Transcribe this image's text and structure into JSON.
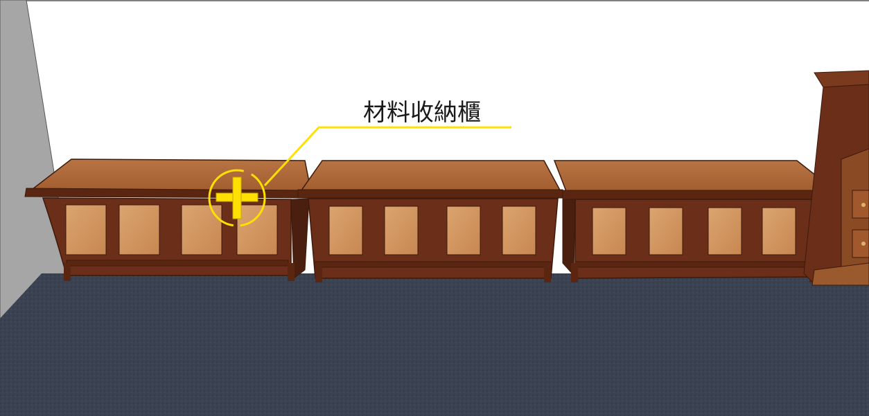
{
  "scene": {
    "callout": {
      "label": "材料收納櫃",
      "color": "#FFE000"
    },
    "colors": {
      "wall": "#ffffff",
      "side_wall": "#a6a6a6",
      "carpet": "#3b4352",
      "wood_frame": "#6b2e18",
      "wood_top": "#b26d3a",
      "panel": "#d39a64"
    },
    "icons": {
      "hotspot": "plus-circle-icon"
    }
  }
}
